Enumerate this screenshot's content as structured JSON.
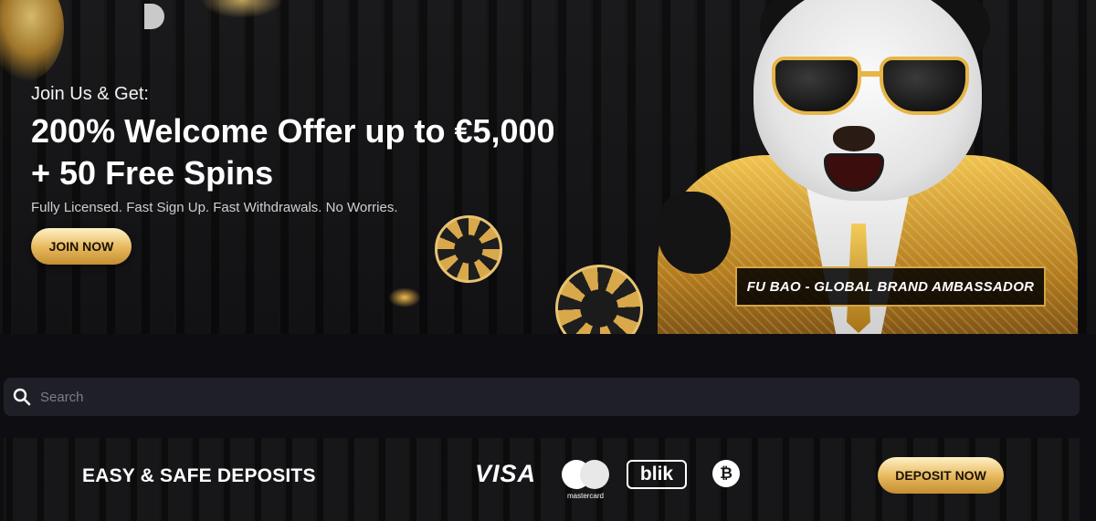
{
  "hero": {
    "eyebrow": "Join Us & Get:",
    "headline_line1": "200% Welcome Offer up to €5,000",
    "headline_line2": "+ 50 Free Spins",
    "subline": "Fully Licensed. Fast Sign Up. Fast Withdrawals. No Worries.",
    "cta_label": "JOIN NOW",
    "ambassador_caption": "FU BAO - GLOBAL BRAND AMBASSADOR"
  },
  "search": {
    "placeholder": "Search",
    "value": ""
  },
  "deposit_banner": {
    "title": "EASY & SAFE DEPOSITS",
    "payment_methods": [
      "VISA",
      "mastercard",
      "blik",
      "₿"
    ],
    "cta_label": "DEPOSIT NOW"
  },
  "colors": {
    "gold_accent": "#e6b65a",
    "background": "#0d0d12",
    "search_bg": "#1f1f27"
  },
  "icons": {
    "search": "search-icon",
    "bitcoin": "bitcoin-icon",
    "mastercard": "mastercard-logo",
    "visa": "visa-logo",
    "blik": "blik-logo"
  }
}
